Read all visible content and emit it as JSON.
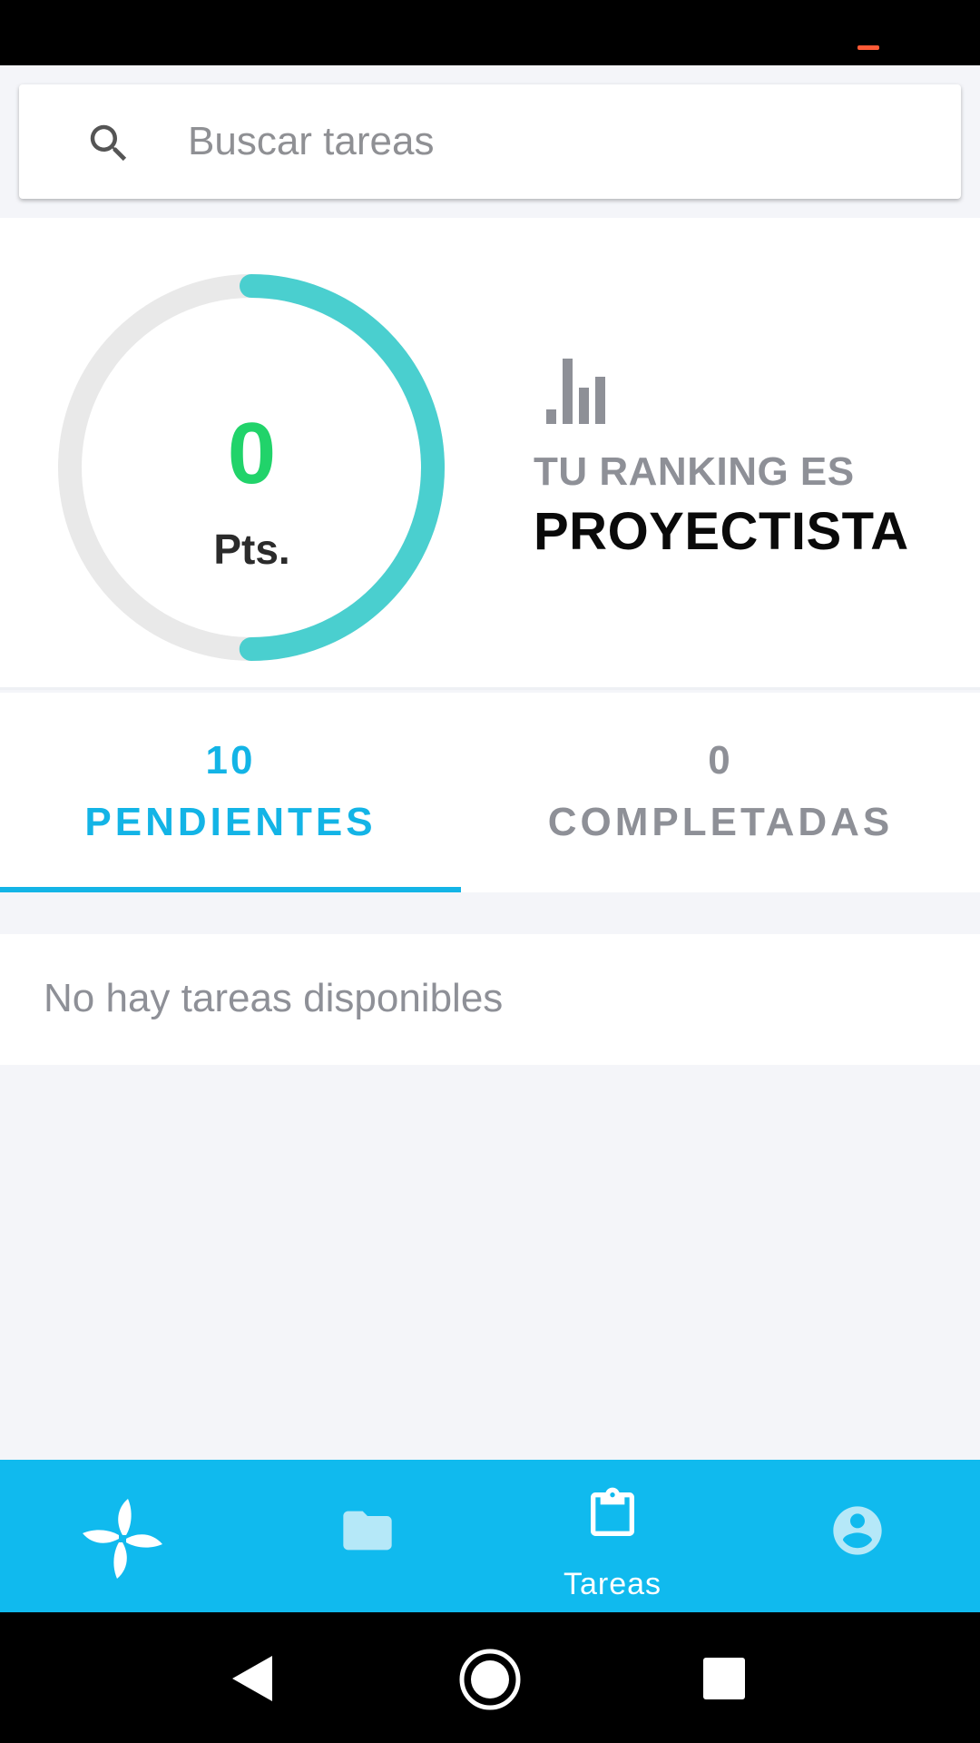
{
  "search": {
    "placeholder": "Buscar tareas",
    "icon": "search-icon"
  },
  "score": {
    "points": "0",
    "unit": "Pts.",
    "ring_progress": 0.5,
    "ring_color": "#4acfcf",
    "ring_track_color": "#e9e9e9",
    "points_color": "#21d36a"
  },
  "ranking": {
    "icon": "bar-chart-icon",
    "label": "TU RANKING ES",
    "value": "PROYECTISTA"
  },
  "tabs": [
    {
      "count": "10",
      "label": "PENDIENTES",
      "active": true
    },
    {
      "count": "0",
      "label": "COMPLETADAS",
      "active": false
    }
  ],
  "tasks": {
    "empty_message": "No hay tareas disponibles"
  },
  "bottom_nav": {
    "accent": "#10baee",
    "items": [
      {
        "icon": "pinwheel-logo-icon",
        "label": ""
      },
      {
        "icon": "folder-icon",
        "label": ""
      },
      {
        "icon": "clipboard-icon",
        "label": "Tareas",
        "active": true
      },
      {
        "icon": "account-circle-icon",
        "label": ""
      }
    ]
  },
  "colors": {
    "accent": "#13b4e6",
    "muted": "#8e9097",
    "background": "#f4f5f9"
  }
}
